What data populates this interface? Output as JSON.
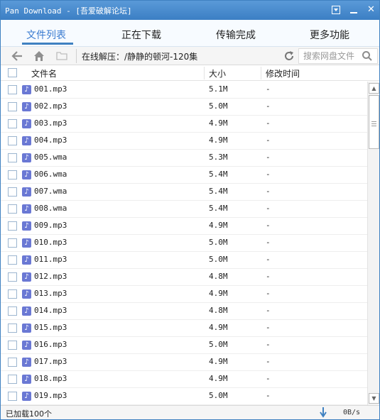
{
  "window": {
    "title": "Pan Download - [吾爱破解论坛]"
  },
  "tabs": [
    {
      "label": "文件列表",
      "active": true
    },
    {
      "label": "正在下载",
      "active": false
    },
    {
      "label": "传输完成",
      "active": false
    },
    {
      "label": "更多功能",
      "active": false
    }
  ],
  "nav": {
    "back_icon": "back-arrow-icon",
    "home_icon": "home-icon",
    "folder_icon": "folder-icon",
    "path_label": "在线解压：/静静的顿河-120集",
    "refresh_icon": "refresh-icon",
    "search_placeholder": "搜索网盘文件",
    "search_icon": "search-icon"
  },
  "columns": {
    "name": "文件名",
    "size": "大小",
    "mtime": "修改时间"
  },
  "files": [
    {
      "name": "001.mp3",
      "size": "5.1M",
      "mtime": "-"
    },
    {
      "name": "002.mp3",
      "size": "5.0M",
      "mtime": "-"
    },
    {
      "name": "003.mp3",
      "size": "4.9M",
      "mtime": "-"
    },
    {
      "name": "004.mp3",
      "size": "4.9M",
      "mtime": "-"
    },
    {
      "name": "005.wma",
      "size": "5.3M",
      "mtime": "-"
    },
    {
      "name": "006.wma",
      "size": "5.4M",
      "mtime": "-"
    },
    {
      "name": "007.wma",
      "size": "5.4M",
      "mtime": "-"
    },
    {
      "name": "008.wma",
      "size": "5.4M",
      "mtime": "-"
    },
    {
      "name": "009.mp3",
      "size": "4.9M",
      "mtime": "-"
    },
    {
      "name": "010.mp3",
      "size": "5.0M",
      "mtime": "-"
    },
    {
      "name": "011.mp3",
      "size": "5.0M",
      "mtime": "-"
    },
    {
      "name": "012.mp3",
      "size": "4.8M",
      "mtime": "-"
    },
    {
      "name": "013.mp3",
      "size": "4.9M",
      "mtime": "-"
    },
    {
      "name": "014.mp3",
      "size": "4.8M",
      "mtime": "-"
    },
    {
      "name": "015.mp3",
      "size": "4.9M",
      "mtime": "-"
    },
    {
      "name": "016.mp3",
      "size": "5.0M",
      "mtime": "-"
    },
    {
      "name": "017.mp3",
      "size": "4.9M",
      "mtime": "-"
    },
    {
      "name": "018.mp3",
      "size": "4.9M",
      "mtime": "-"
    },
    {
      "name": "019.mp3",
      "size": "5.0M",
      "mtime": "-"
    }
  ],
  "status": {
    "loaded_text": "已加载100个",
    "speed": "0B/s"
  },
  "colors": {
    "accent": "#3f81c1",
    "title_bar": "#4a8dcf",
    "music_icon": "#6a78d4"
  }
}
